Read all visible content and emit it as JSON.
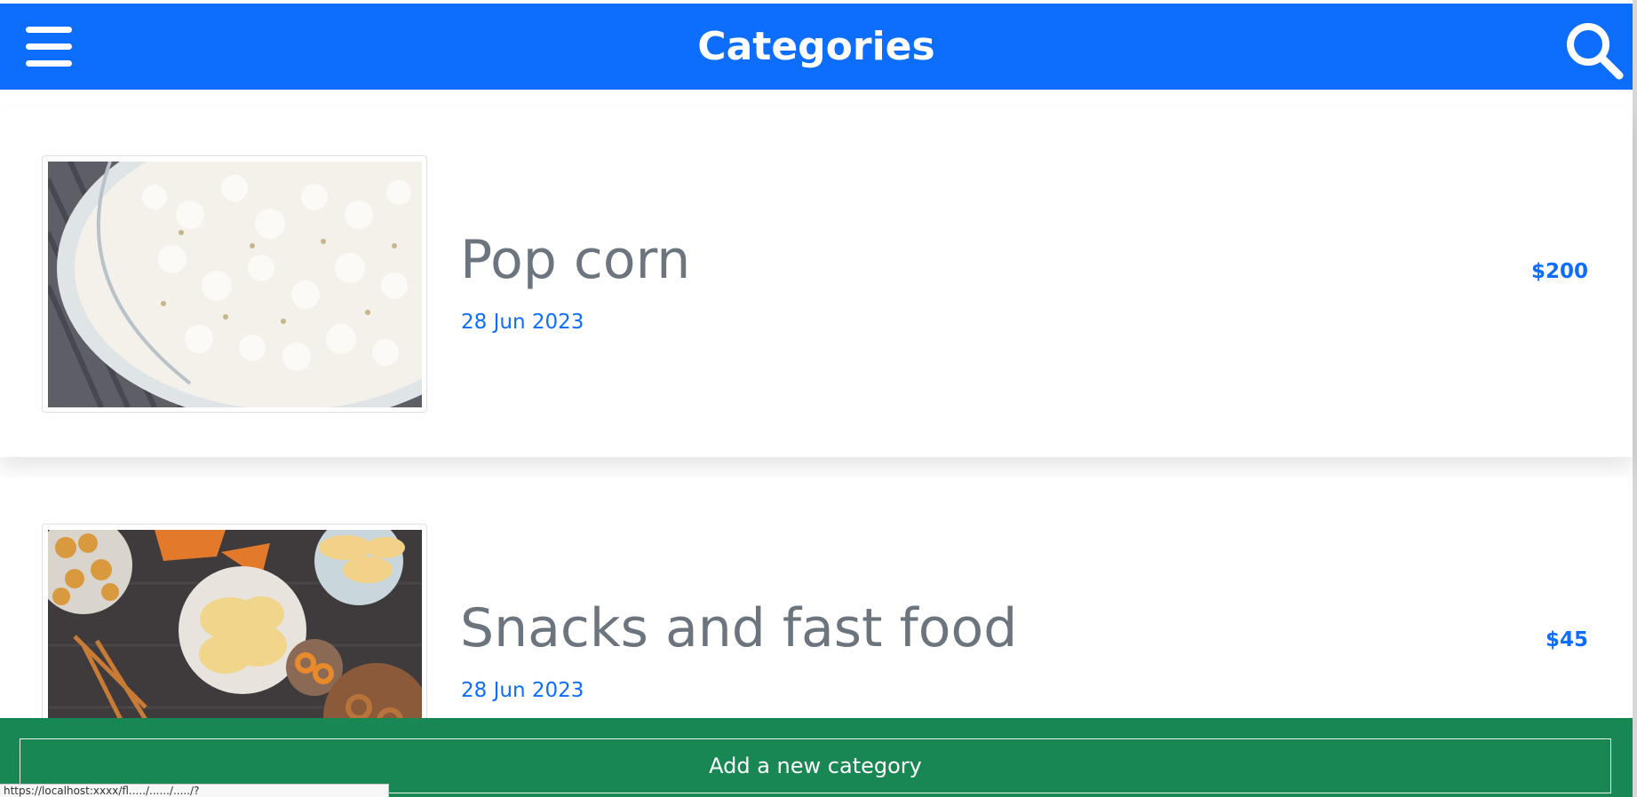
{
  "header": {
    "title": "Categories",
    "menu_icon": "hamburger-menu-icon",
    "search_icon": "search-icon"
  },
  "categories": [
    {
      "name": "Pop corn",
      "date": "28 Jun 2023",
      "price": "$200",
      "image": "popcorn-bowl-photo"
    },
    {
      "name": "Snacks and fast food",
      "date": "28 Jun 2023",
      "price": "$45",
      "image": "snacks-table-photo"
    }
  ],
  "footer": {
    "add_label": "Add a new category"
  },
  "status_bar": {
    "url": "https://localhost:xxxx/fl...../....../...../?"
  },
  "colors": {
    "primary": "#0d6efd",
    "success": "#198754",
    "muted_text": "#6c757d"
  }
}
